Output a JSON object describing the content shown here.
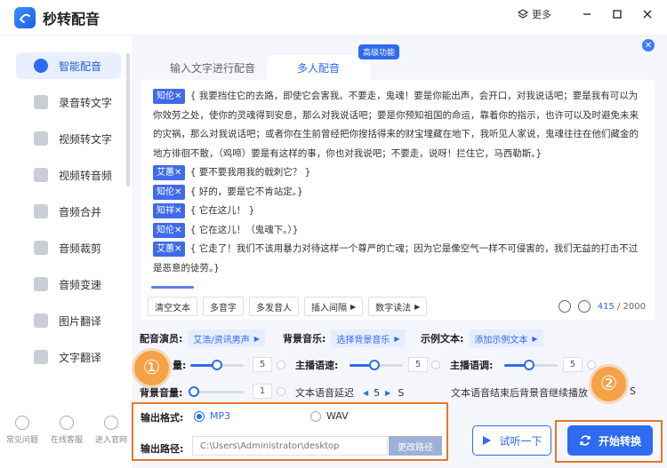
{
  "app": {
    "title": "秒转配音",
    "more_label": "更多"
  },
  "sidebar": {
    "items": [
      {
        "label": "智能配音",
        "icon": "mic-icon"
      },
      {
        "label": "录音转文字",
        "icon": "record-text-icon"
      },
      {
        "label": "视频转文字",
        "icon": "video-text-icon"
      },
      {
        "label": "视频转音频",
        "icon": "video-audio-icon"
      },
      {
        "label": "音频合并",
        "icon": "audio-merge-icon"
      },
      {
        "label": "音频裁剪",
        "icon": "scissors-icon"
      },
      {
        "label": "音频变速",
        "icon": "speed-icon"
      },
      {
        "label": "图片翻译",
        "icon": "image-translate-icon"
      },
      {
        "label": "文字翻译",
        "icon": "text-translate-icon"
      }
    ],
    "bottom": [
      {
        "label": "常见问题",
        "icon": "question-icon"
      },
      {
        "label": "在线客服",
        "icon": "chat-icon"
      },
      {
        "label": "进入官网",
        "icon": "home-icon"
      }
    ]
  },
  "tabs": [
    {
      "label": "输入文字进行配音"
    },
    {
      "label": "多人配音"
    }
  ],
  "advanced_badge": "高级功能",
  "script": [
    {
      "speaker": "知伦✕",
      "text": "{ 我要挡住它的去路，即使它会害我。不要走，鬼魂！要是你能出声，会开口，对我说话吧；要是我有可以为你效劳之处，使你的灵魂得到安息，那么对我说话吧；要是你预知祖国的命运，靠着你的指示，也许可以及时避免未来的灾祸，那么对我说话吧；或者你在生前曾经把你搜括得来的财宝埋藏在地下，我听见人家说，鬼魂往往在他们藏金的地方徘徊不散，（鸡啼）要是有这样的事，你也对我说吧；不要走，说呀！拦住它，马西勒斯。}"
    },
    {
      "speaker": "艾蕙✕",
      "text": "{ 要不要我用我的戟刺它？ }"
    },
    {
      "speaker": "知伦✕",
      "text": "{ 好的，要是它不肯站定。}"
    },
    {
      "speaker": "知祥✕",
      "text": "{ 它在这儿！ }"
    },
    {
      "speaker": "知伦✕",
      "text": "{ 它在这儿！（鬼魂下。）}"
    },
    {
      "speaker": "艾蕙✕",
      "text": "{ 它走了！我们不该用暴力对待这样一个尊严的亡魂；因为它是像空气一样不可侵害的，我们无益的打击不过是恶意的徒劳。}"
    }
  ],
  "tools": [
    {
      "label": "清空文本",
      "arrow": ""
    },
    {
      "label": "多音字",
      "arrow": ""
    },
    {
      "label": "多发音人",
      "arrow": ""
    },
    {
      "label": "插入间隔",
      "arrow": "▶"
    },
    {
      "label": "数字读法",
      "arrow": "▶"
    }
  ],
  "counter": {
    "current": "415",
    "max": " / 2000"
  },
  "settings": {
    "voice_label": "配音演员:",
    "voice_value": "艾浩/资讯男声",
    "bgm_label": "背景音乐:",
    "bgm_value": "选择背景音乐",
    "sample_label": "示例文本:",
    "sample_value": "添加示例文本",
    "vol_label": "量:",
    "vol_value": "5",
    "speed_label": "主播语速:",
    "speed_value": "5",
    "pitch_label": "主播语调:",
    "pitch_value": "5",
    "bgvol_label": "背景音量:",
    "bgvol_value": "1",
    "delay_label": "文本语音延迟",
    "delay_value": "5",
    "delay_unit": "S",
    "continue_label": "文本语音结束后背景音继续播放",
    "continue_unit": "S"
  },
  "output": {
    "format_label": "输出格式:",
    "format_mp3": "MP3",
    "format_wav": "WAV",
    "path_label": "输出路径:",
    "path_value": "C:\\Users\\Administrator\\desktop",
    "path_button": "更改路径"
  },
  "markers": {
    "one": "①",
    "two": "②"
  },
  "buttons": {
    "trial": "试听一下",
    "start": "开始转换"
  },
  "colors": {
    "accent": "#2f6bf0",
    "highlight": "#e6762d",
    "marker": "#f5a146"
  }
}
